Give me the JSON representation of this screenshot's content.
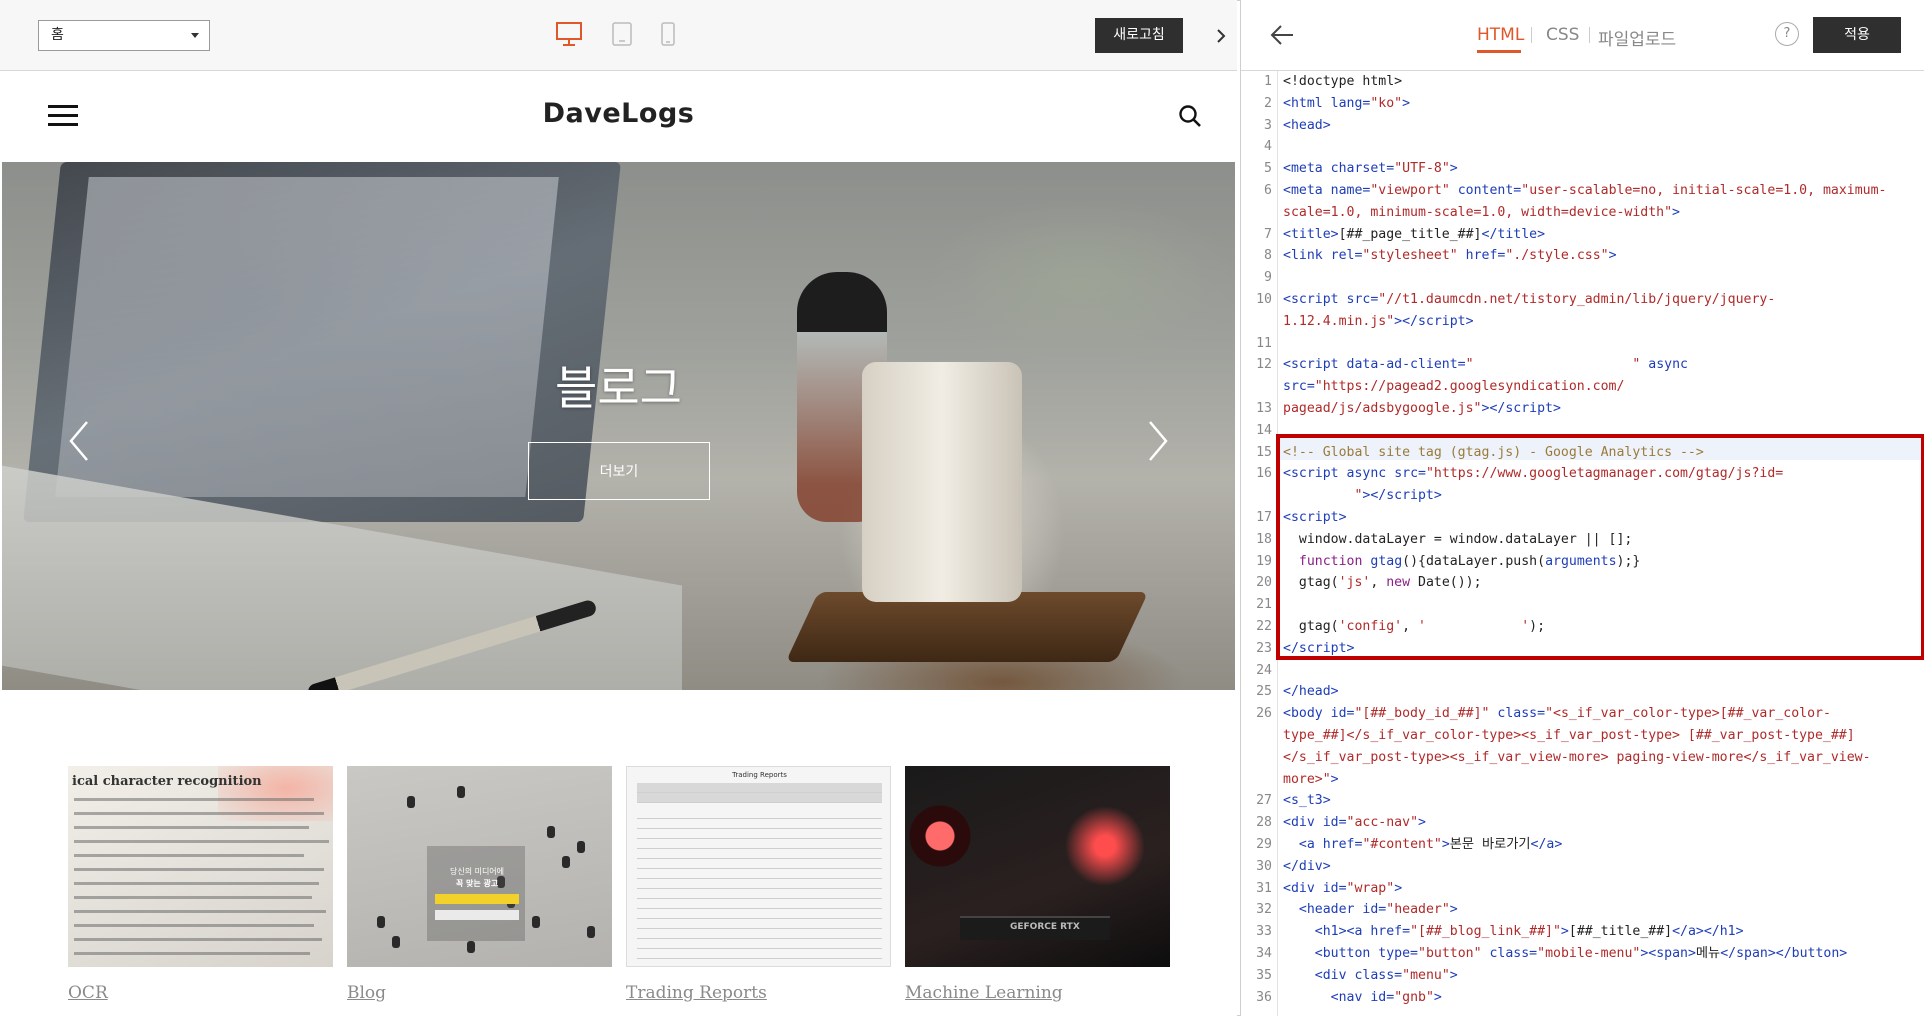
{
  "preview": {
    "page_select": "홈",
    "refresh_label": "새로고침",
    "brand": "DaveLogs",
    "hero_title": "블로그",
    "hero_button": "더보기",
    "thumbs": [
      {
        "label": "OCR"
      },
      {
        "label": "Blog"
      },
      {
        "label": "Trading Reports"
      },
      {
        "label": "Machine Learning"
      }
    ],
    "thumb_text": {
      "ocr_heading": "ical character recognition",
      "blog_line1": "당신의 미디어에",
      "blog_line2": "꼭 맞는 광고",
      "report_title": "Trading Reports",
      "gpu_text": "GEFORCE RTX"
    }
  },
  "editor": {
    "tabs": [
      "HTML",
      "CSS",
      "파일업로드"
    ],
    "active_tab": "HTML",
    "help_label": "?",
    "apply_label": "적용",
    "highlight_color": "#c00000",
    "active_tab_color": "#e0582a",
    "line_numbers": [
      "1",
      "2",
      "3",
      "4",
      "5",
      "6",
      "",
      "7",
      "8",
      "9",
      "10",
      "",
      "11",
      "12",
      "",
      "13",
      "14",
      "15",
      "16",
      "",
      "17",
      "18",
      "19",
      "20",
      "21",
      "22",
      "23",
      "24",
      "25",
      "26",
      "",
      "",
      "",
      "27",
      "28",
      "29",
      "30",
      "31",
      "32",
      "33",
      "34",
      "35",
      "36"
    ]
  }
}
